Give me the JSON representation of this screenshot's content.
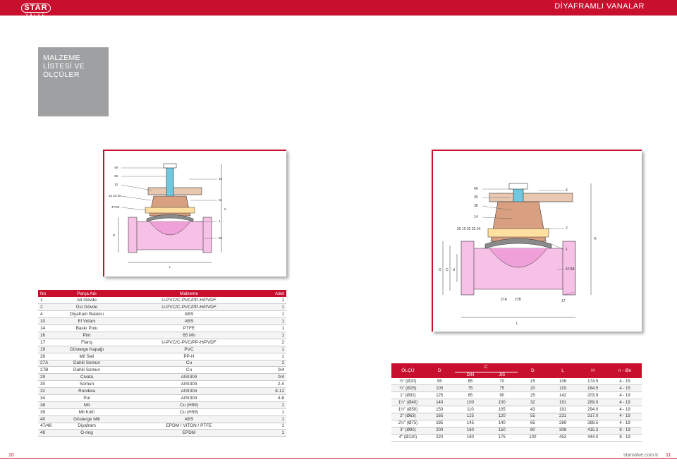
{
  "header": {
    "logo_top": "STAR",
    "logo_bottom": "VALVE",
    "title": "DİYAFRAMLI VANALAR"
  },
  "section": {
    "line1": "MALZEME",
    "line2": "LİSTESİ VE",
    "line3": "ÖLÇÜLER"
  },
  "drawing1": {
    "labels": [
      "49",
      "38",
      "10",
      "32 33 29",
      "47/48",
      "16",
      "40",
      "34",
      "26",
      "1",
      "2",
      "4",
      "14",
      "39",
      "16",
      "27",
      "30",
      "L",
      "D",
      "H"
    ]
  },
  "drawing2": {
    "labels": [
      "40",
      "39",
      "38",
      "16",
      "14",
      "26 10 32 33 34",
      "27B",
      "4",
      "2",
      "1",
      "47/48",
      "17",
      "27A",
      "27B",
      "D",
      "C",
      "d",
      "L",
      "H"
    ]
  },
  "parts_table": {
    "headers": {
      "no": "No",
      "adi": "Parça Adı",
      "malzeme": "Malzeme",
      "adet": "Adet"
    },
    "rows": [
      {
        "no": "1",
        "adi": "Alt Gövde",
        "malzeme": "U-PVC/C-PVC/PP-H/PVDF",
        "adet": "1"
      },
      {
        "no": "2",
        "adi": "Üst Gövde",
        "malzeme": "U-PVC/C-PVC/PP-H/PVDF",
        "adet": "1"
      },
      {
        "no": "4",
        "adi": "Diyafram Baskısı",
        "malzeme": "ABS",
        "adet": "1"
      },
      {
        "no": "10",
        "adi": "El Volanı",
        "malzeme": "ABS",
        "adet": "1"
      },
      {
        "no": "14",
        "adi": "Baskı Pulu",
        "malzeme": "PTFE",
        "adet": "1"
      },
      {
        "no": "16",
        "adi": "Pim",
        "malzeme": "65 Mn",
        "adet": "1"
      },
      {
        "no": "17",
        "adi": "Flanş",
        "malzeme": "U-PVC/C-PVC/PP-H/PVDF",
        "adet": "2"
      },
      {
        "no": "19",
        "adi": "Gösterge Kapağı",
        "malzeme": "PVC",
        "adet": "1"
      },
      {
        "no": "26",
        "adi": "Mil Seti",
        "malzeme": "PP-H",
        "adet": "1"
      },
      {
        "no": "27A",
        "adi": "Dahili Somun",
        "malzeme": "Cu",
        "adet": "2"
      },
      {
        "no": "27B",
        "adi": "Dahili Somun",
        "malzeme": "Cu",
        "adet": "0/4"
      },
      {
        "no": "29",
        "adi": "Civata",
        "malzeme": "AISI304",
        "adet": "0/4"
      },
      {
        "no": "30",
        "adi": "Somun",
        "malzeme": "AISI304",
        "adet": "2-4"
      },
      {
        "no": "32",
        "adi": "Rondela",
        "malzeme": "AISI304",
        "adet": "8-12"
      },
      {
        "no": "34",
        "adi": "Pul",
        "malzeme": "AISI304",
        "adet": "4-8"
      },
      {
        "no": "38",
        "adi": "Mil",
        "malzeme": "Cu (H59)",
        "adet": "1"
      },
      {
        "no": "39",
        "adi": "Mil Kılıfı",
        "malzeme": "Cu (H59)",
        "adet": "1"
      },
      {
        "no": "40",
        "adi": "Gösterge Mili",
        "malzeme": "ABS",
        "adet": "1"
      },
      {
        "no": "47/48",
        "adi": "Diyafram",
        "malzeme": "EPDM / VITON / PTFE",
        "adet": "1"
      },
      {
        "no": "49",
        "adi": "O-ring",
        "malzeme": "EPDM",
        "adet": "1"
      }
    ]
  },
  "dims_table": {
    "headers": {
      "olcu": "ÖLÇÜ",
      "D": "D",
      "C": "C",
      "din": "DIN",
      "jis": "JIS",
      "d": "D",
      "L": "L",
      "H": "H",
      "n": "n - Øe"
    },
    "rows": [
      {
        "olcu": "½\" (Ø20)",
        "D": "95",
        "din": "65",
        "jis": "70",
        "d": "15",
        "L": "106",
        "H": "174.5",
        "n": "4 - 15"
      },
      {
        "olcu": "¾\" (Ø25)",
        "D": "105",
        "din": "75",
        "jis": "75",
        "d": "20",
        "L": "119",
        "H": "184.5",
        "n": "4 - 15"
      },
      {
        "olcu": "1\" (Ø32)",
        "D": "125",
        "din": "85",
        "jis": "90",
        "d": "25",
        "L": "142",
        "H": "203.9",
        "n": "4 - 19"
      },
      {
        "olcu": "1¼\" (Ø40)",
        "D": "140",
        "din": "100",
        "jis": "100",
        "d": "32",
        "L": "191",
        "H": "289.0",
        "n": "4 - 19"
      },
      {
        "olcu": "1½\" (Ø50)",
        "D": "150",
        "din": "110",
        "jis": "105",
        "d": "43",
        "L": "191",
        "H": "294.0",
        "n": "4 - 19"
      },
      {
        "olcu": "2\" (Ø63)",
        "D": "165",
        "din": "125",
        "jis": "120",
        "d": "55",
        "L": "231",
        "H": "317.0",
        "n": "4 - 19"
      },
      {
        "olcu": "2½\" (Ø75)",
        "D": "185",
        "din": "145",
        "jis": "140",
        "d": "65",
        "L": "269",
        "H": "388.5",
        "n": "4 - 19"
      },
      {
        "olcu": "3\" (Ø90)",
        "D": "200",
        "din": "160",
        "jis": "150",
        "d": "80",
        "L": "308",
        "H": "415.3",
        "n": "8 - 19"
      },
      {
        "olcu": "4\" (Ø110)",
        "D": "220",
        "din": "180",
        "jis": "175",
        "d": "100",
        "L": "453",
        "H": "444.0",
        "n": "8 - 19"
      }
    ]
  },
  "footer": {
    "page_left": "10",
    "site": "starvalve.com.tr",
    "page_right": "11"
  },
  "colors": {
    "brand_red": "#c8102e",
    "section_grey": "#9fa0a2",
    "diaphragm_pink": "#f0a0d8",
    "stem_blue": "#6fc8e0"
  }
}
